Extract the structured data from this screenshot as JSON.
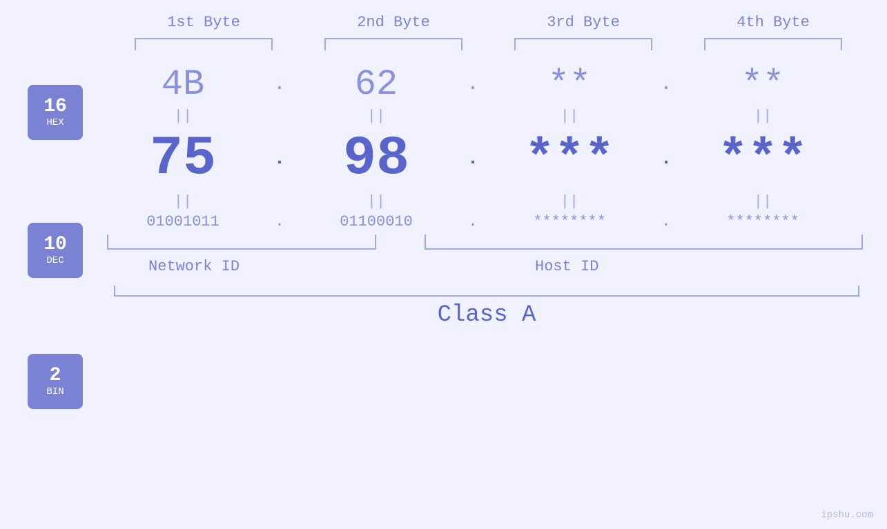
{
  "headers": {
    "byte1": "1st Byte",
    "byte2": "2nd Byte",
    "byte3": "3rd Byte",
    "byte4": "4th Byte"
  },
  "labels": {
    "hex": {
      "num": "16",
      "base": "HEX"
    },
    "dec": {
      "num": "10",
      "base": "DEC"
    },
    "bin": {
      "num": "2",
      "base": "BIN"
    }
  },
  "hex_values": [
    "4B",
    "62",
    "**",
    "**"
  ],
  "dec_values": [
    "75",
    "98",
    "***",
    "***"
  ],
  "bin_values": [
    "01001011",
    "01100010",
    "********",
    "********"
  ],
  "dots": [
    ".",
    ".",
    ".",
    ""
  ],
  "network_id": "Network ID",
  "host_id": "Host ID",
  "class_label": "Class A",
  "attribution": "ipshu.com"
}
